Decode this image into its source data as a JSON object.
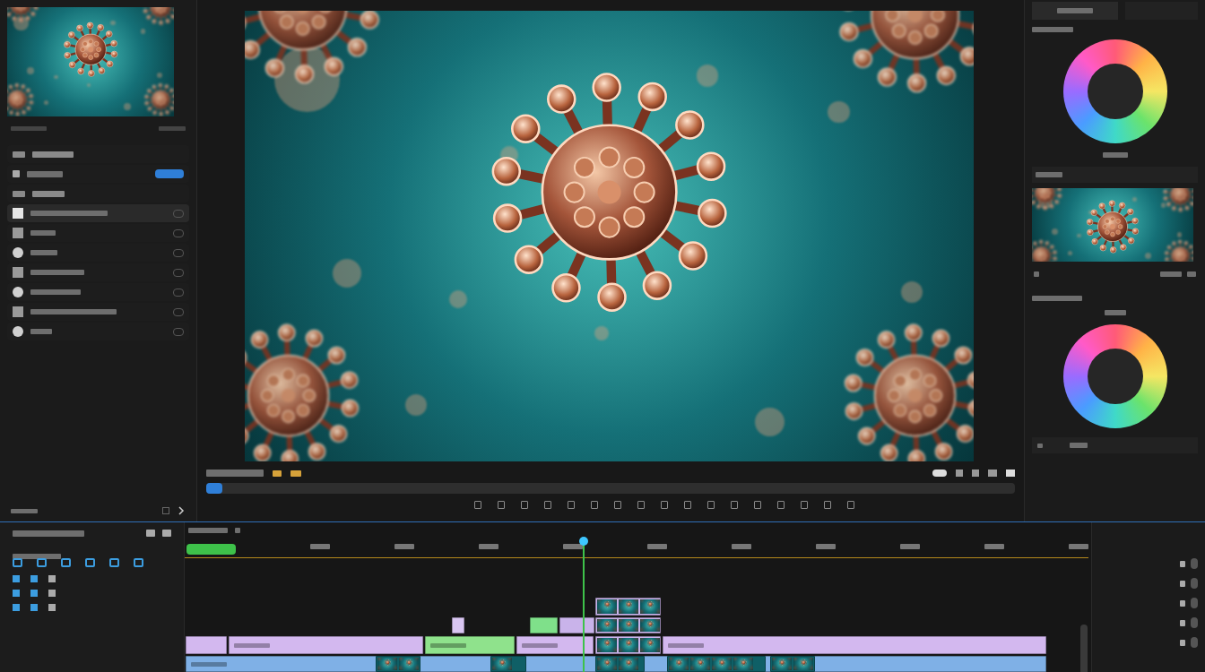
{
  "left_panel": {
    "rows": [
      {
        "kind": "heading",
        "selected": false
      },
      {
        "kind": "toggle",
        "selected": false
      },
      {
        "kind": "heading",
        "selected": false
      },
      {
        "kind": "item",
        "selected": true
      },
      {
        "kind": "item",
        "selected": false
      },
      {
        "kind": "item",
        "selected": false
      },
      {
        "kind": "item",
        "selected": false
      },
      {
        "kind": "item",
        "selected": false
      },
      {
        "kind": "item",
        "selected": false
      },
      {
        "kind": "item",
        "selected": false
      }
    ]
  },
  "viewer": {
    "scrub_level": 0.02,
    "transport_count": 17
  },
  "right_panel": {
    "wheels": [
      {
        "ring": "full"
      },
      {
        "ring": "full"
      }
    ]
  },
  "timeline": {
    "playhead_level": 0.44,
    "work_area_level": 0.055,
    "tracks": [
      {
        "clips": [
          {
            "start": 458,
            "end": 531,
            "color": "#c9b3ea",
            "kind": "thumb"
          }
        ]
      },
      {
        "clips": [
          {
            "start": 298,
            "end": 312,
            "color": "#d9c6f2",
            "kind": "plain"
          },
          {
            "start": 385,
            "end": 416,
            "color": "#7fe08a",
            "kind": "plain"
          },
          {
            "start": 418,
            "end": 457,
            "color": "#c9b3ea",
            "kind": "plain"
          },
          {
            "start": 458,
            "end": 531,
            "color": "#c9b3ea",
            "kind": "thumb"
          }
        ]
      },
      {
        "clips": [
          {
            "start": 1,
            "end": 47,
            "color": "#d3b8ef",
            "kind": "plain"
          },
          {
            "start": 49,
            "end": 266,
            "color": "#d3b8ef",
            "kind": "plain"
          },
          {
            "start": 268,
            "end": 368,
            "color": "#8fe28c",
            "kind": "plain"
          },
          {
            "start": 370,
            "end": 456,
            "color": "#d3b8ef",
            "kind": "plain"
          },
          {
            "start": 458,
            "end": 531,
            "color": "#c9b3ea",
            "kind": "thumb"
          },
          {
            "start": 533,
            "end": 961,
            "color": "#d3b8ef",
            "kind": "plain"
          }
        ]
      },
      {
        "clips": [
          {
            "start": 1,
            "end": 961,
            "color": "#7fb0e6",
            "kind": "plain"
          },
          {
            "start": 213,
            "end": 263,
            "color": "#0f5f66",
            "kind": "thumb"
          },
          {
            "start": 341,
            "end": 381,
            "color": "#0f5f66",
            "kind": "thumb"
          },
          {
            "start": 458,
            "end": 513,
            "color": "#0f5f66",
            "kind": "thumb"
          },
          {
            "start": 538,
            "end": 648,
            "color": "#0f5f66",
            "kind": "thumb"
          },
          {
            "start": 653,
            "end": 703,
            "color": "#0f5f66",
            "kind": "thumb"
          }
        ]
      }
    ]
  }
}
